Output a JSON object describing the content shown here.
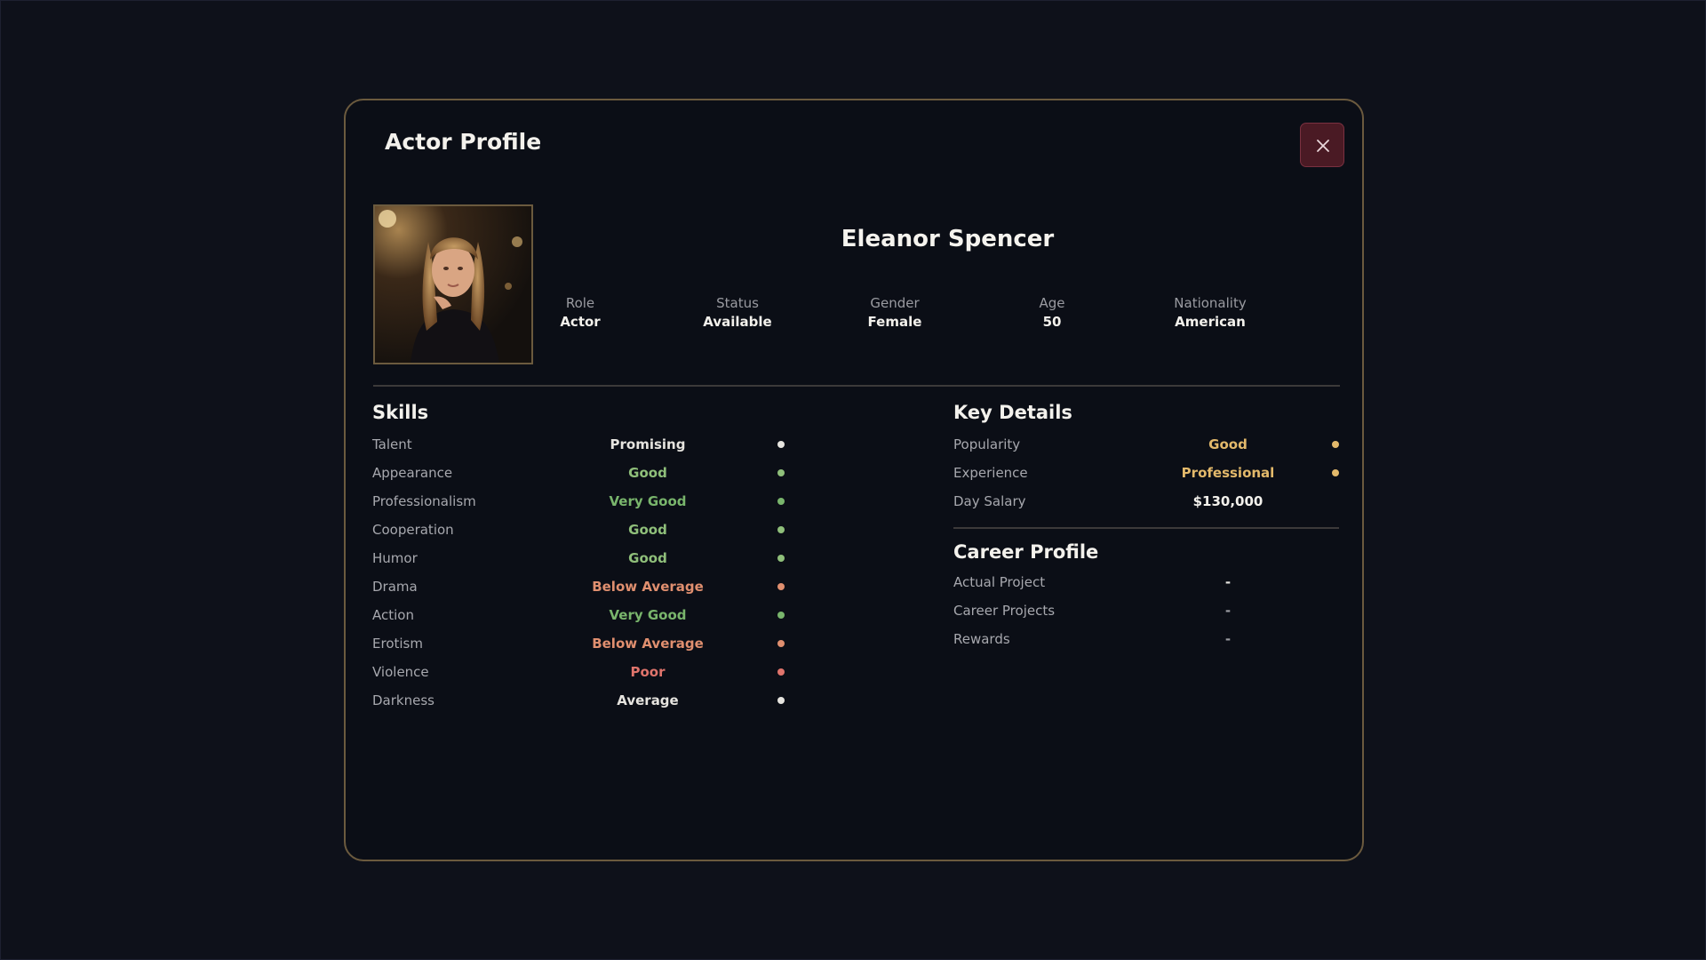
{
  "modal": {
    "title": "Actor Profile"
  },
  "actor": {
    "name": "Eleanor Spencer",
    "info": [
      {
        "label": "Role",
        "value": "Actor"
      },
      {
        "label": "Status",
        "value": "Available"
      },
      {
        "label": "Gender",
        "value": "Female"
      },
      {
        "label": "Age",
        "value": "50"
      },
      {
        "label": "Nationality",
        "value": "American"
      }
    ]
  },
  "skills": {
    "title": "Skills",
    "items": [
      {
        "label": "Talent",
        "value": "Promising",
        "color": "#e6e4df"
      },
      {
        "label": "Appearance",
        "value": "Good",
        "color": "#8fbf7a"
      },
      {
        "label": "Professionalism",
        "value": "Very Good",
        "color": "#79b56c"
      },
      {
        "label": "Cooperation",
        "value": "Good",
        "color": "#8fbf7a"
      },
      {
        "label": "Humor",
        "value": "Good",
        "color": "#8fbf7a"
      },
      {
        "label": "Drama",
        "value": "Below Average",
        "color": "#e08f6f"
      },
      {
        "label": "Action",
        "value": "Very Good",
        "color": "#79b56c"
      },
      {
        "label": "Erotism",
        "value": "Below Average",
        "color": "#e08f6f"
      },
      {
        "label": "Violence",
        "value": "Poor",
        "color": "#e0746c"
      },
      {
        "label": "Darkness",
        "value": "Average",
        "color": "#e6e4df"
      }
    ]
  },
  "key_details": {
    "title": "Key Details",
    "items": [
      {
        "label": "Popularity",
        "value": "Good",
        "color": "#e3b96b",
        "dot": true
      },
      {
        "label": "Experience",
        "value": "Professional",
        "color": "#e3b96b",
        "dot": true
      },
      {
        "label": "Day Salary",
        "value": "$130,000",
        "color": "#f3f1ec",
        "dot": false
      }
    ]
  },
  "career": {
    "title": "Career Profile",
    "items": [
      {
        "label": "Actual Project",
        "value": "-"
      },
      {
        "label": "Career Projects",
        "value": "-"
      },
      {
        "label": "Rewards",
        "value": "-"
      }
    ]
  },
  "icons": {
    "close": "close-icon",
    "portrait": "actor-portrait"
  },
  "colors": {
    "accent_border": "#6b5a3e",
    "close_bg": "#4a1a24"
  }
}
